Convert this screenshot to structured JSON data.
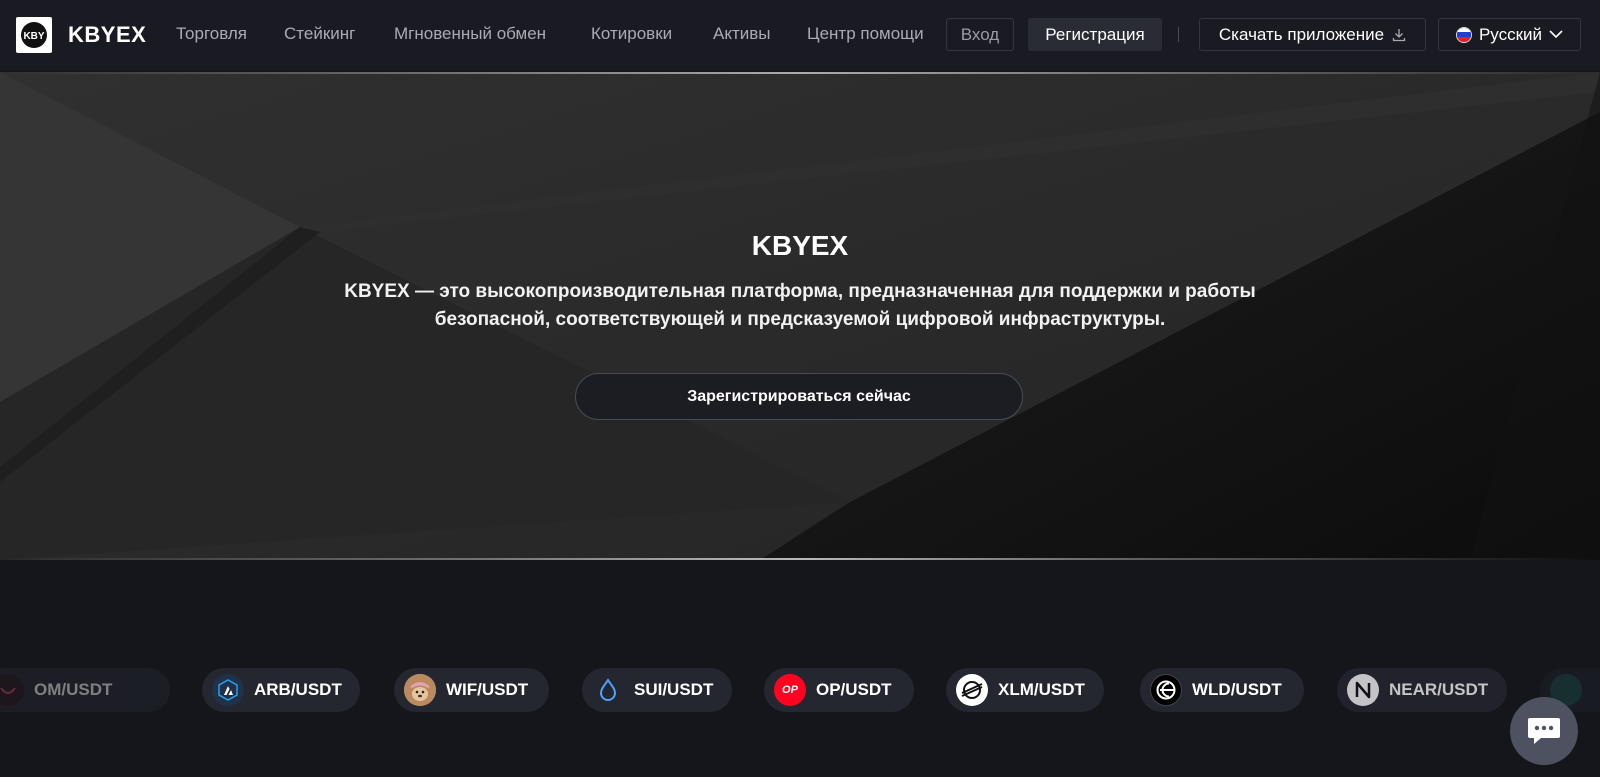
{
  "header": {
    "logo_text": "KBY",
    "brand": "KBYEX",
    "nav": [
      {
        "label": "Торговля"
      },
      {
        "label": "Стейкинг"
      },
      {
        "label": "Мгновенный обмен"
      },
      {
        "label": "Котировки"
      },
      {
        "label": "Активы"
      },
      {
        "label": "Центр помощи"
      }
    ],
    "login_label": "Вход",
    "register_label": "Регистрация",
    "download_label": "Скачать приложение",
    "language_label": "Русский"
  },
  "hero": {
    "title": "KBYEX",
    "desc_line1": "KBYEX — это высокопроизводительная платформа, предназначенная для поддержки и работы",
    "desc_line2": "безопасной, соответствующей и предсказуемой цифровой инфраструктуры.",
    "cta_label": "Зарегистрироваться сейчас"
  },
  "ticker": [
    {
      "pair": "OM/USDT",
      "icon": "om-icon"
    },
    {
      "pair": "ARB/USDT",
      "icon": "arb-icon"
    },
    {
      "pair": "WIF/USDT",
      "icon": "wif-icon"
    },
    {
      "pair": "SUI/USDT",
      "icon": "sui-icon"
    },
    {
      "pair": "OP/USDT",
      "icon": "op-icon",
      "icon_text": "OP"
    },
    {
      "pair": "XLM/USDT",
      "icon": "xlm-icon"
    },
    {
      "pair": "WLD/USDT",
      "icon": "wld-icon"
    },
    {
      "pair": "NEAR/USDT",
      "icon": "near-icon"
    }
  ],
  "colors": {
    "header_bg": "#1a1b22",
    "page_bg": "#15161c",
    "pill_bg": "#252730",
    "op_red": "#ff0420",
    "sui_blue": "#4da2ff",
    "arb_blue": "#28a0f0"
  }
}
